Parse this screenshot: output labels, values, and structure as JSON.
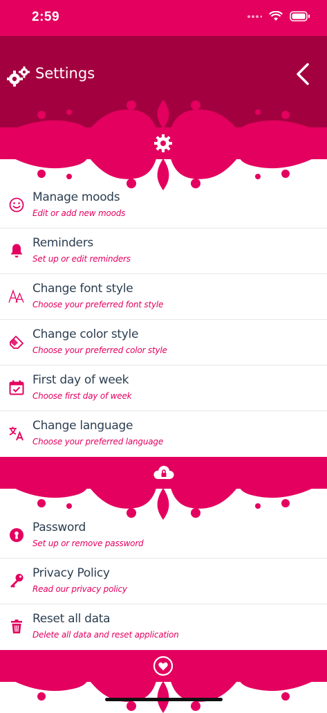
{
  "status": {
    "time": "2:59"
  },
  "header": {
    "title": "Settings"
  },
  "colors": {
    "accent": "#e3005f",
    "header": "#a3003f",
    "title_text": "#2c3e50"
  },
  "sections": [
    {
      "icon": "gear-badge-icon",
      "items": [
        {
          "icon": "smiley-icon",
          "title": "Manage moods",
          "subtitle": "Edit or add new moods"
        },
        {
          "icon": "bell-icon",
          "title": "Reminders",
          "subtitle": "Set up or edit reminders"
        },
        {
          "icon": "font-icon",
          "title": "Change font style",
          "subtitle": "Choose your preferred font style"
        },
        {
          "icon": "eraser-icon",
          "title": "Change color style",
          "subtitle": "Choose your preferred color style"
        },
        {
          "icon": "calendar-check-icon",
          "title": "First day of week",
          "subtitle": "Choose first day of week"
        },
        {
          "icon": "translate-icon",
          "title": "Change language",
          "subtitle": "Choose your preferred language"
        }
      ]
    },
    {
      "icon": "cloud-lock-icon",
      "items": [
        {
          "icon": "keyhole-icon",
          "title": "Password",
          "subtitle": "Set up or remove password"
        },
        {
          "icon": "key-icon",
          "title": "Privacy Policy",
          "subtitle": "Read our privacy policy"
        },
        {
          "icon": "trash-icon",
          "title": "Reset all data",
          "subtitle": "Delete all data and reset application"
        }
      ]
    },
    {
      "icon": "heart-icon",
      "items": []
    }
  ]
}
